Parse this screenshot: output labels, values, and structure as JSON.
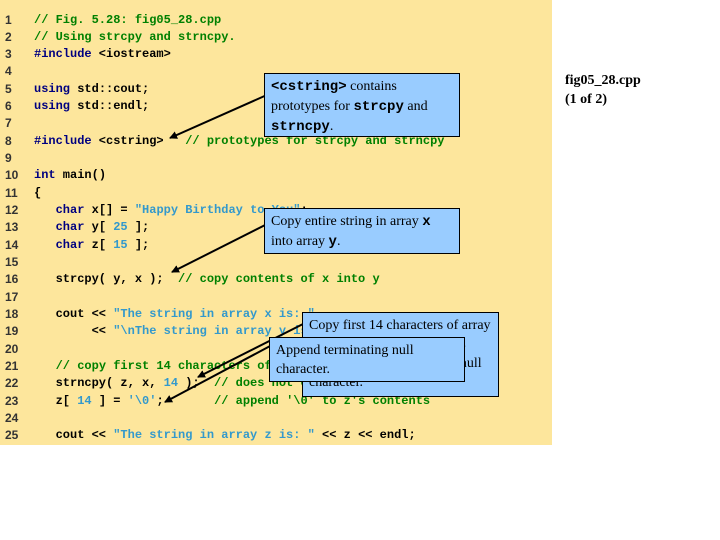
{
  "slide": {
    "filename": "fig05_28.cpp",
    "page": "(1 of 2)",
    "colors": {
      "panel": "#FDE69C",
      "callout": "#99CCFF",
      "keyword": "#000080",
      "comment": "#008000",
      "string": "#3399CC"
    }
  },
  "code": [
    {
      "n": "1",
      "t": [
        [
          "cm",
          "// Fig. 5.28: fig05_28.cpp"
        ]
      ]
    },
    {
      "n": "2",
      "t": [
        [
          "cm",
          "// Using strcpy and strncpy."
        ]
      ]
    },
    {
      "n": "3",
      "t": [
        [
          "kw",
          "#include"
        ],
        [
          "pl",
          " <iostream>"
        ]
      ]
    },
    {
      "n": "4",
      "t": []
    },
    {
      "n": "5",
      "t": [
        [
          "kw",
          "using"
        ],
        [
          "pl",
          " std::cout;"
        ]
      ]
    },
    {
      "n": "6",
      "t": [
        [
          "kw",
          "using"
        ],
        [
          "pl",
          " std::endl;"
        ]
      ]
    },
    {
      "n": "7",
      "t": []
    },
    {
      "n": "8",
      "t": [
        [
          "kw",
          "#include"
        ],
        [
          "pl",
          " <cstring>   "
        ],
        [
          "cm",
          "// prototypes for strcpy and strncpy"
        ]
      ]
    },
    {
      "n": "9",
      "t": []
    },
    {
      "n": "10",
      "t": [
        [
          "kw",
          "int"
        ],
        [
          "pl",
          " main()"
        ]
      ]
    },
    {
      "n": "11",
      "t": [
        [
          "pl",
          "{"
        ]
      ]
    },
    {
      "n": "12",
      "t": [
        [
          "pl",
          "   "
        ],
        [
          "kw",
          "char"
        ],
        [
          "pl",
          " x[] = "
        ],
        [
          "st",
          "\"Happy Birthday to You\""
        ],
        [
          "pl",
          ";"
        ]
      ]
    },
    {
      "n": "13",
      "t": [
        [
          "pl",
          "   "
        ],
        [
          "kw",
          "char"
        ],
        [
          "pl",
          " y[ "
        ],
        [
          "nm",
          "25"
        ],
        [
          "pl",
          " ];"
        ]
      ]
    },
    {
      "n": "14",
      "t": [
        [
          "pl",
          "   "
        ],
        [
          "kw",
          "char"
        ],
        [
          "pl",
          " z[ "
        ],
        [
          "nm",
          "15"
        ],
        [
          "pl",
          " ];"
        ]
      ]
    },
    {
      "n": "15",
      "t": []
    },
    {
      "n": "16",
      "t": [
        [
          "pl",
          "   strcpy( y, x );  "
        ],
        [
          "cm",
          "// copy contents of x into y"
        ]
      ]
    },
    {
      "n": "17",
      "t": []
    },
    {
      "n": "18",
      "t": [
        [
          "pl",
          "   cout << "
        ],
        [
          "st",
          "\"The string in array x is: \""
        ]
      ]
    },
    {
      "n": "19",
      "t": [
        [
          "pl",
          "        << "
        ],
        [
          "st",
          "\"\\nThe string in array y is: \""
        ]
      ]
    },
    {
      "n": "20",
      "t": []
    },
    {
      "n": "21",
      "t": [
        [
          "pl",
          "   "
        ],
        [
          "cm",
          "// copy first 14 characters of x into z"
        ]
      ]
    },
    {
      "n": "22",
      "t": [
        [
          "pl",
          "   strncpy( z, x, "
        ],
        [
          "nm",
          "14"
        ],
        [
          "pl",
          " );  "
        ],
        [
          "cm",
          "// does not copy null character"
        ]
      ]
    },
    {
      "n": "23",
      "t": [
        [
          "pl",
          "   z[ "
        ],
        [
          "nm",
          "14"
        ],
        [
          "pl",
          " ] = "
        ],
        [
          "st",
          "'\\0'"
        ],
        [
          "pl",
          ";       "
        ],
        [
          "cm",
          "// append '\\0' to z's contents"
        ]
      ]
    },
    {
      "n": "24",
      "t": []
    },
    {
      "n": "25",
      "t": [
        [
          "pl",
          "   cout << "
        ],
        [
          "st",
          "\"The string in array z is: \""
        ],
        [
          "pl",
          " << z << endl;"
        ]
      ]
    }
  ],
  "callouts": {
    "cstring": {
      "a": "<cstring>",
      "b": " contains prototypes for ",
      "c": "strcpy",
      "d": " and ",
      "e": "strncpy",
      "f": "."
    },
    "strcpy": {
      "a": "Copy entire string in array ",
      "b": "x",
      "c": " into array ",
      "d": "y",
      "e": "."
    },
    "strncpy": {
      "a": "Copy first 14 characters of array x into array z. Note that this does not write terminating null character."
    },
    "append": {
      "a": "Append terminating null character."
    }
  }
}
